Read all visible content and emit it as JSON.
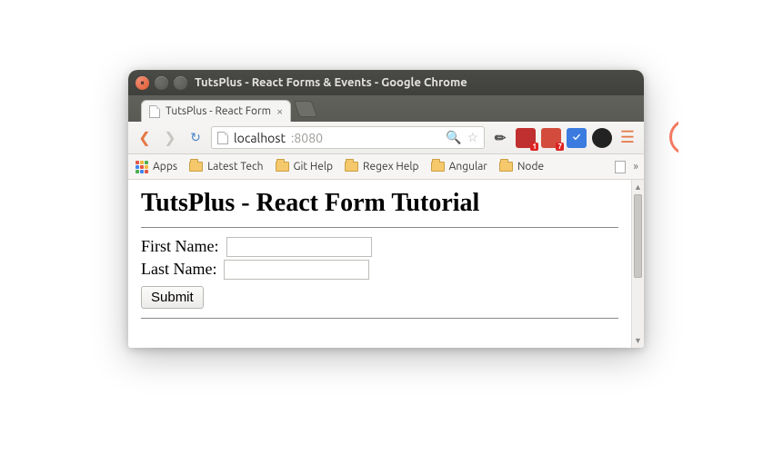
{
  "window": {
    "title": "TutsPlus - React Forms & Events - Google Chrome"
  },
  "tabs": [
    {
      "label": "TutsPlus - React Form"
    }
  ],
  "address": {
    "host": "localhost",
    "port": ":8080"
  },
  "bookmarks": {
    "apps_label": "Apps",
    "items": [
      "Latest Tech",
      "Git Help",
      "Regex Help",
      "Angular",
      "Node"
    ]
  },
  "extensions": {
    "red1_badge": "1",
    "red2_badge": "7",
    "blue_glyph": "✓"
  },
  "page": {
    "heading": "TutsPlus - React Form Tutorial",
    "first_name_label": "First Name:",
    "last_name_label": "Last Name:",
    "first_name_value": "",
    "last_name_value": "",
    "submit_label": "Submit"
  }
}
